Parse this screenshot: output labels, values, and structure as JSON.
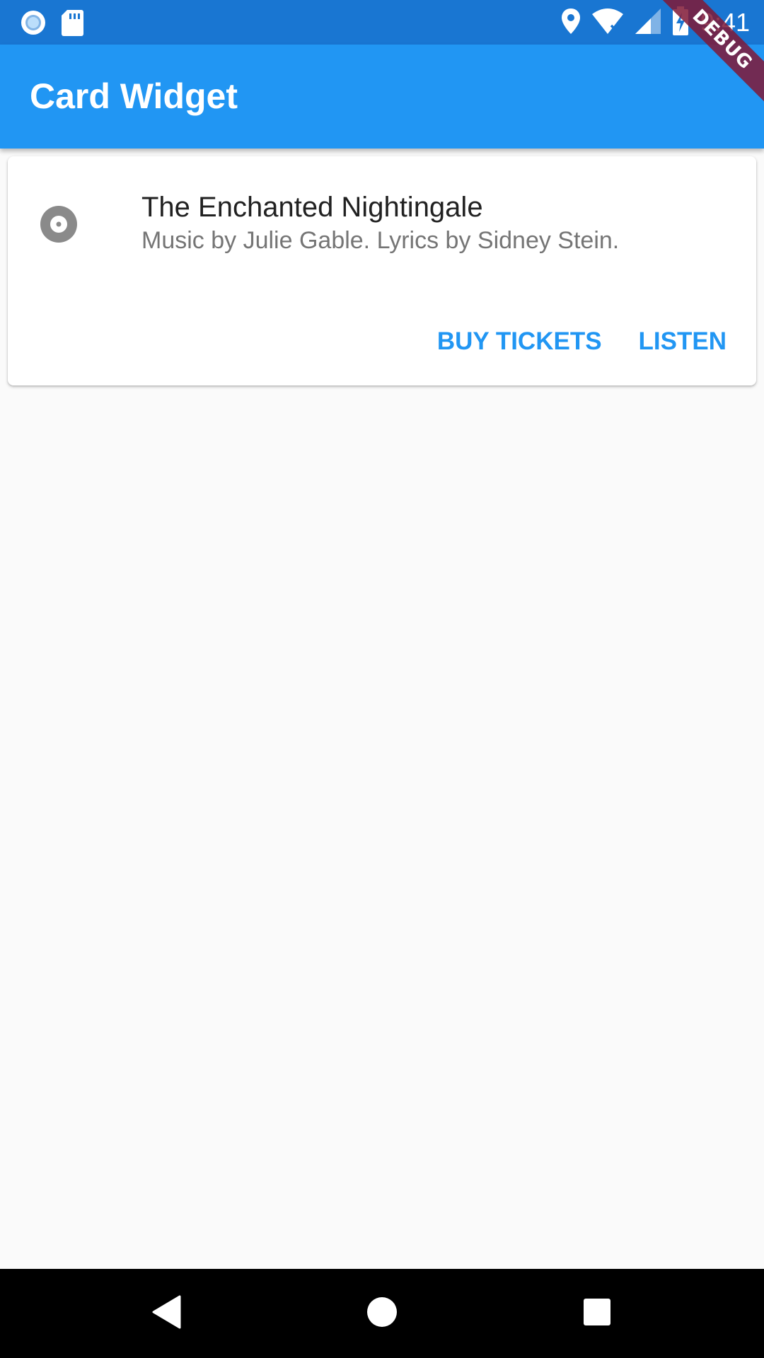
{
  "status_bar": {
    "time": "9:41",
    "icons": [
      "record-icon",
      "sd-card-icon",
      "location-icon",
      "wifi-icon",
      "signal-icon",
      "battery-charging-icon"
    ]
  },
  "app_bar": {
    "title": "Card Widget"
  },
  "debug_banner": {
    "label": "DEBUG"
  },
  "card": {
    "icon": "album-icon",
    "title": "The Enchanted Nightingale",
    "subtitle": "Music by Julie Gable. Lyrics by Sidney Stein.",
    "actions": {
      "buy_tickets": "BUY TICKETS",
      "listen": "LISTEN"
    }
  },
  "nav_bar": {
    "icons": [
      "back-icon",
      "home-icon",
      "recents-icon"
    ]
  },
  "colors": {
    "status_bar": "#1976d2",
    "app_bar": "#2196f3",
    "accent": "#2196f3",
    "background": "#fafafa",
    "debug_banner": "#801936"
  }
}
